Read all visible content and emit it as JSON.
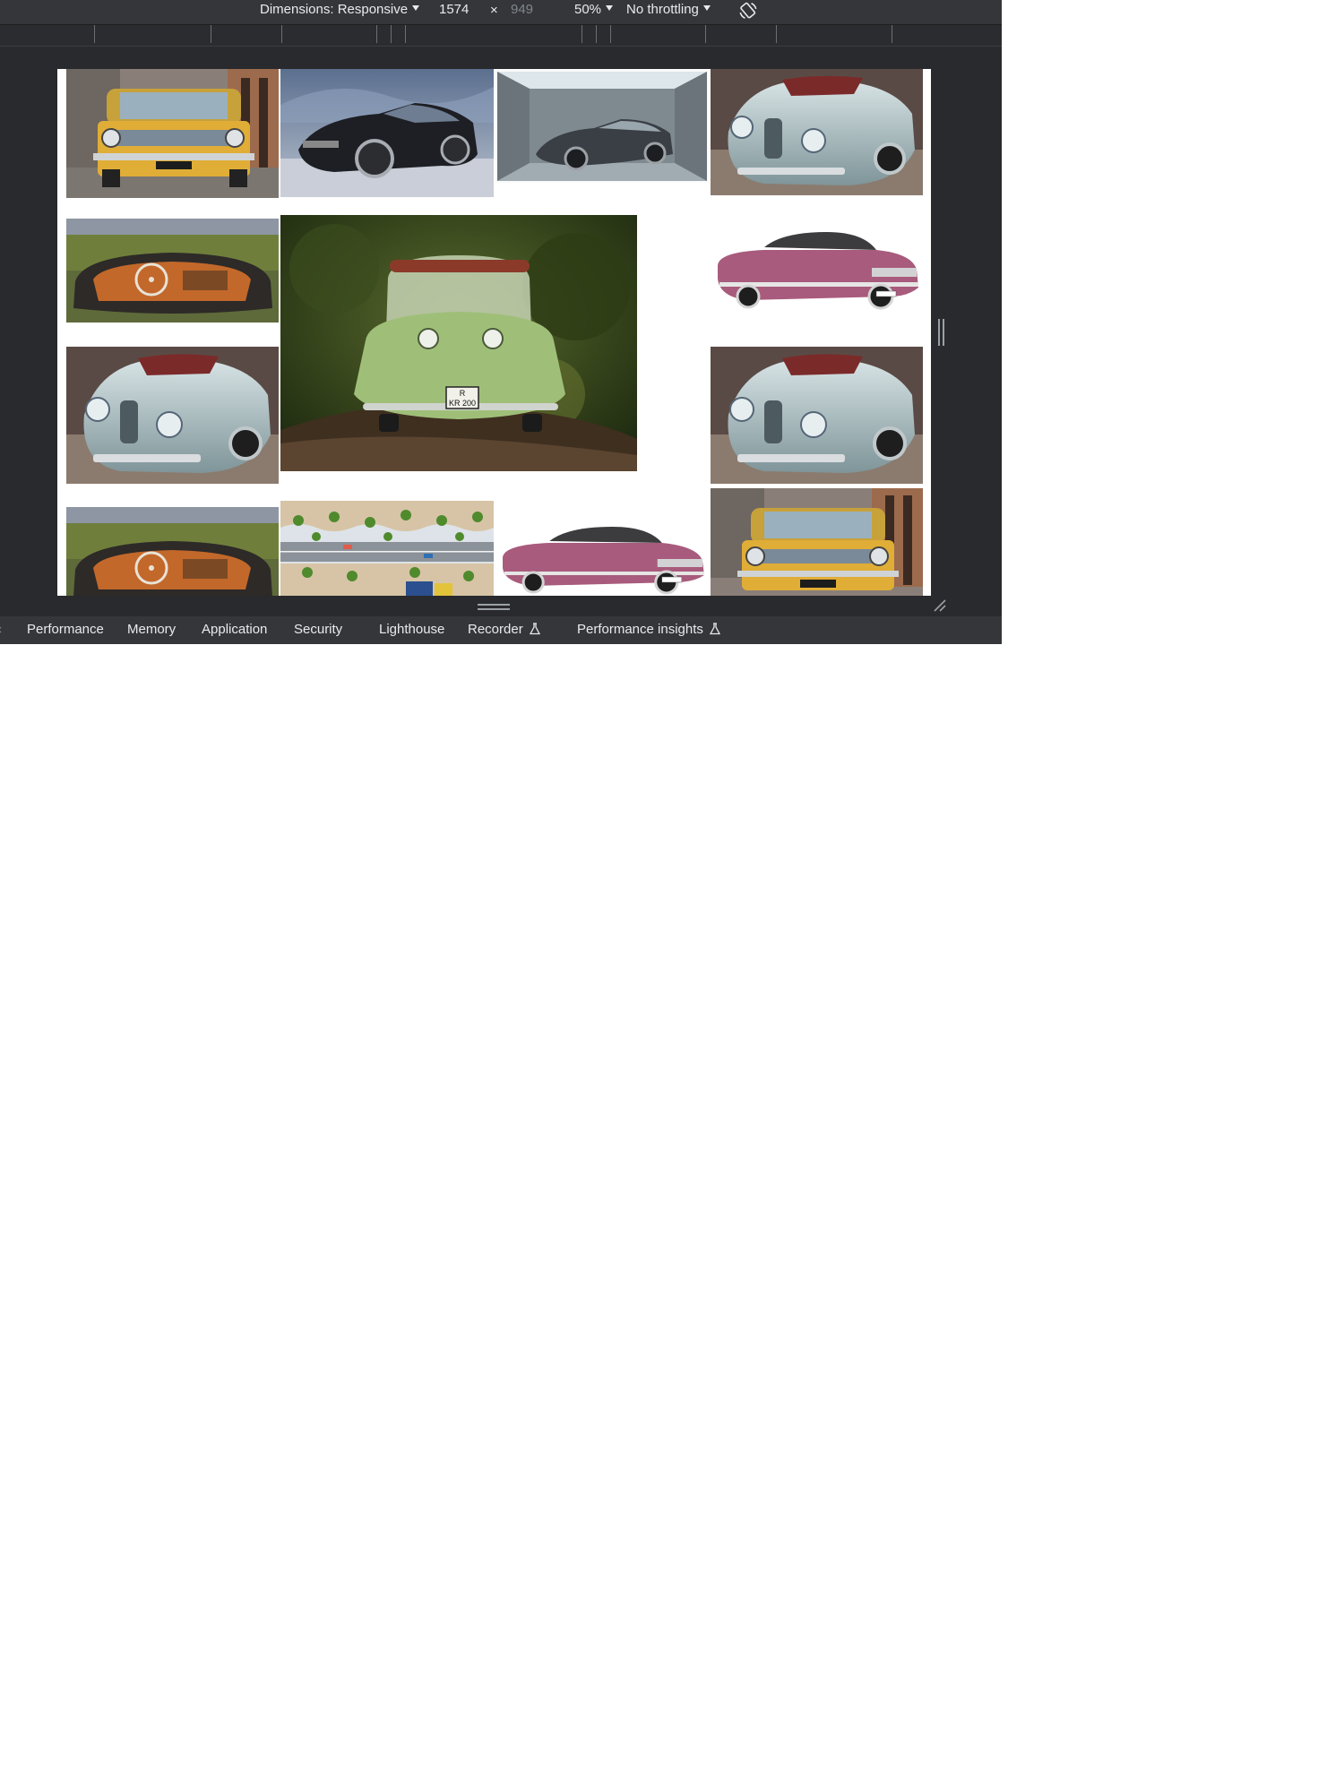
{
  "toolbar": {
    "dimensions_label": "Dimensions: Responsive",
    "width_value": "1574",
    "times_symbol": "×",
    "height_value": "949",
    "zoom": "50%",
    "throttling": "No throttling",
    "rotate_icon": "rotate-icon"
  },
  "viewport": {
    "background": "#ffffff",
    "images": [
      {
        "name": "yellow-lada-sedan",
        "icon": "car-photo"
      },
      {
        "name": "black-mustang-hdr",
        "icon": "car-photo"
      },
      {
        "name": "grey-maserati-room",
        "icon": "car-photo"
      },
      {
        "name": "silver-vintage-convertible",
        "icon": "car-photo"
      },
      {
        "name": "convertible-interior-field",
        "icon": "car-photo"
      },
      {
        "name": "green-bubble-car",
        "icon": "car-photo",
        "plate": [
          "R",
          "KR 200"
        ]
      },
      {
        "name": "pink-classic-coupe",
        "icon": "car-photo"
      },
      {
        "name": "silver-vintage-convertible",
        "icon": "car-photo"
      },
      {
        "name": "silver-vintage-convertible",
        "icon": "car-photo"
      },
      {
        "name": "convertible-interior-field",
        "icon": "car-photo"
      },
      {
        "name": "aerial-palm-road",
        "icon": "car-photo"
      },
      {
        "name": "pink-classic-coupe",
        "icon": "car-photo"
      },
      {
        "name": "yellow-lada-sedan",
        "icon": "car-photo"
      }
    ]
  },
  "tabs": [
    {
      "label": "Performance",
      "experimental": false
    },
    {
      "label": "Memory",
      "experimental": false
    },
    {
      "label": "Application",
      "experimental": false
    },
    {
      "label": "Security",
      "experimental": false
    },
    {
      "label": "Lighthouse",
      "experimental": false
    },
    {
      "label": "Recorder",
      "experimental": true
    },
    {
      "label": "Performance insights",
      "experimental": true
    }
  ],
  "colors": {
    "devtools_bg": "#292a2d",
    "toolbar_bg": "#35363a",
    "text": "#e8eaed",
    "muted_text": "#80868b"
  }
}
